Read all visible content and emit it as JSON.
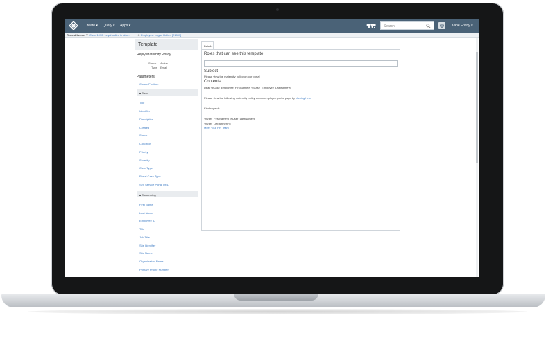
{
  "navbar": {
    "menus": [
      "Create",
      "Query",
      "Apps"
    ],
    "search_placeholder": "Search",
    "user": "Kane Frisby"
  },
  "recent": {
    "label": "Recent Items:",
    "item1": "Case 1010: Legal called in abs...",
    "item2": "Employee: Logan Holten [21801]"
  },
  "left": {
    "header": "Template",
    "template_name": "Reply Maternity Policy",
    "status_label": "Status",
    "status_value": "Active",
    "type_label": "Type",
    "type_value": "Email",
    "params_title": "Parameters",
    "cursor_position": "Cursor Position",
    "case_section": "Case",
    "case_items": [
      "Title",
      "Identifier",
      "Description",
      "Created",
      "Status",
      "Condition",
      "Priority",
      "Severity",
      "Case Type",
      "Portal Case Type",
      "Self Service Portal URL"
    ],
    "concerning_section": "Concerning",
    "concerning_items": [
      "First Name",
      "Last Name",
      "Employee ID",
      "Title",
      "Job Title",
      "Site Identifier",
      "Site Name",
      "Organization Name",
      "Primary Phone Number"
    ]
  },
  "main": {
    "tab_details": "Details",
    "roles_title": "Roles that can see this template",
    "subject_title": "Subject",
    "subject_text": "Please view the maternity policy on our portal",
    "contents_title": "Contents",
    "dear_line": "Dear %Case_Employee_FirstName% %Case_Employee_LastName%",
    "policy_line": "Please view the following maternity policy on our employee portal page by",
    "policy_link": "clicking here",
    "kind_regards": "Kind regards",
    "sig_name": "%User_FirstName% %User_LastName%",
    "sig_dept": "%User_Department%",
    "sig_team": "Meet Your HR Team"
  }
}
